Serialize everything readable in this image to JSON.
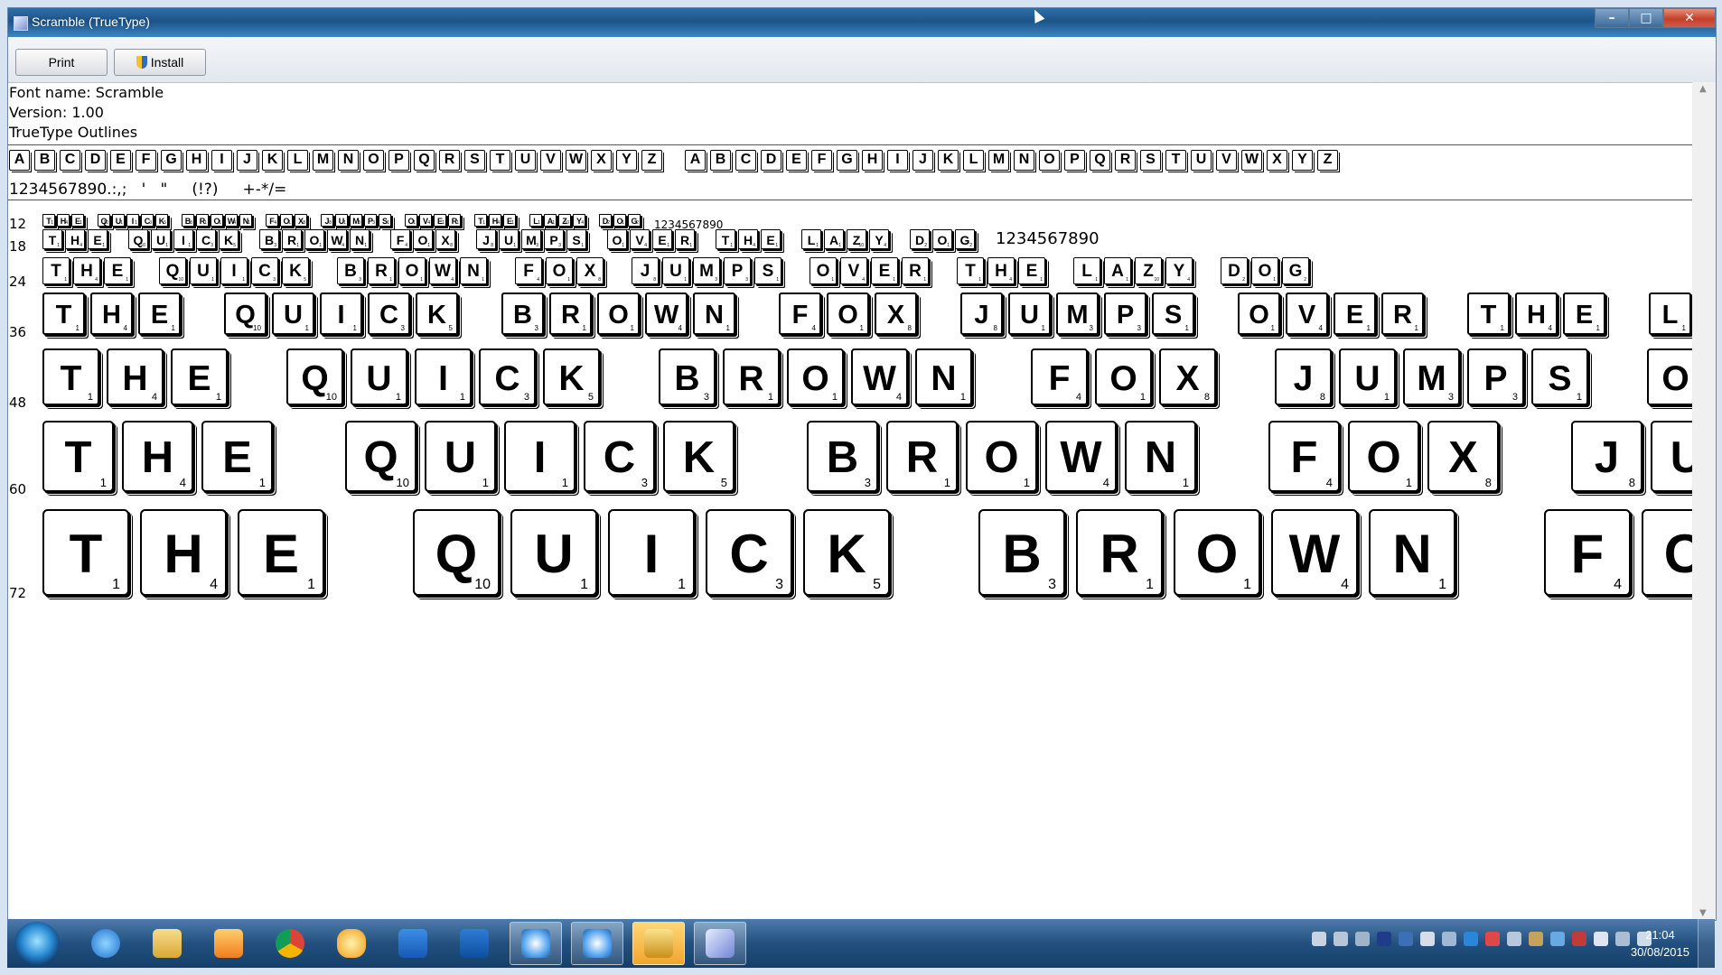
{
  "window": {
    "title": "Scramble (TrueType)",
    "controls": {
      "minimize": "–",
      "maximize": "□",
      "close": "✕"
    }
  },
  "toolbar": {
    "print_label": "Print",
    "install_label": "Install"
  },
  "info": {
    "font_name": "Font name: Scramble",
    "version": "Version: 1.00",
    "outlines": "TrueType Outlines"
  },
  "alphabet": [
    "A",
    "B",
    "C",
    "D",
    "E",
    "F",
    "G",
    "H",
    "I",
    "J",
    "K",
    "L",
    "M",
    "N",
    "O",
    "P",
    "Q",
    "R",
    "S",
    "T",
    "U",
    "V",
    "W",
    "X",
    "Y",
    "Z"
  ],
  "charset_line": "1234567890.:,;   '   \"     (!?)     +-*/=",
  "sample_numbers": "1234567890",
  "sample_words": [
    "THE",
    "QUICK",
    "BROWN",
    "FOX",
    "JUMPS",
    "OVER",
    "THE",
    "LAZY",
    "DOG"
  ],
  "letter_points": {
    "A": 1,
    "B": 3,
    "C": 3,
    "D": 2,
    "E": 1,
    "F": 4,
    "G": 2,
    "H": 4,
    "I": 1,
    "J": 8,
    "K": 5,
    "L": 1,
    "M": 3,
    "N": 1,
    "O": 1,
    "P": 3,
    "Q": 10,
    "R": 1,
    "S": 1,
    "T": 1,
    "U": 1,
    "V": 4,
    "W": 4,
    "X": 8,
    "Y": 4,
    "Z": 10
  },
  "sizes": [
    "12",
    "18",
    "24",
    "36",
    "48",
    "60",
    "72"
  ],
  "taskbar": {
    "apps": [
      "start-button",
      "internet-explorer",
      "windows-explorer",
      "media-player",
      "chrome",
      "photo-app",
      "lync",
      "outlook",
      "snowflake-app",
      "snowflake-app-2",
      "archive-app",
      "font-viewer"
    ],
    "clock_time": "21:04",
    "clock_date": "30/08/2015"
  }
}
